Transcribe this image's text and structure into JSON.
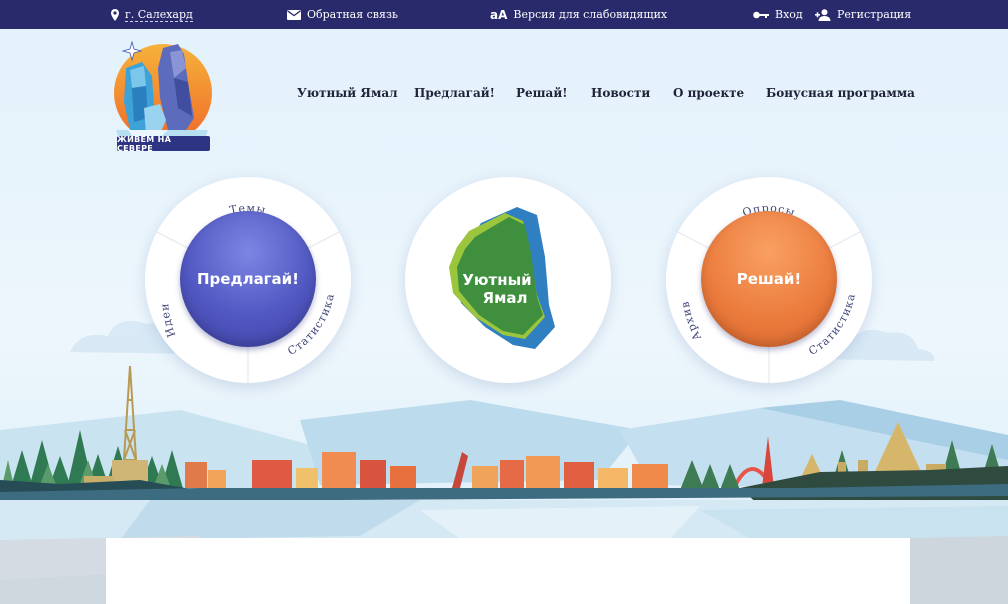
{
  "topbar": {
    "city": "г. Салехард",
    "feedback": "Обратная связь",
    "accessibility_glyph": "аA",
    "accessibility": "Версия для слабовидящих",
    "login": "Вход",
    "register": "Регистрация"
  },
  "logo": {
    "text": "ЖИВЁМ НА СЕВЕРЕ"
  },
  "nav": {
    "items": [
      "Уютный Ямал",
      "Предлагай!",
      "Решай!",
      "Новости",
      "О проекте",
      "Бонусная программа"
    ]
  },
  "left_wheel": {
    "center": "Предлагай!",
    "labels": [
      "Темы",
      "Идеи",
      "Статистика"
    ]
  },
  "center_wheel": {
    "line1": "Уютный",
    "line2": "Ямал"
  },
  "right_wheel": {
    "center": "Решай!",
    "labels": [
      "Опросы",
      "Архив",
      "Статистика"
    ]
  },
  "colors": {
    "topbar": "#282a6b",
    "propose": "#5158c2",
    "decide": "#ea7a3c",
    "yamal_green": "#3f8f3e",
    "yamal_lime": "#9bc53d",
    "yamal_blue": "#2f7fc1"
  },
  "icons": [
    "location-pin-icon",
    "envelope-icon",
    "key-icon",
    "user-plus-icon"
  ]
}
